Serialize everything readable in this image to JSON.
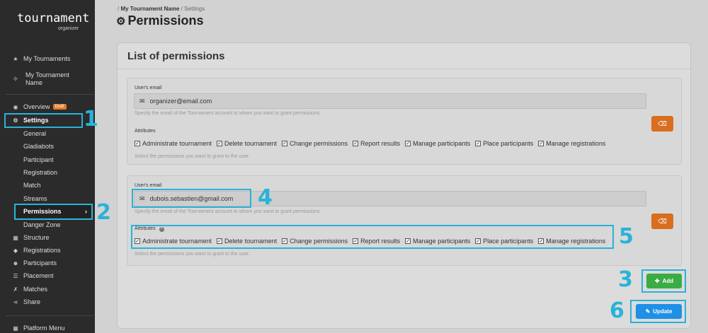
{
  "sidebar": {
    "logo_text": "tournament",
    "logo_sub": "organizer",
    "my_tournaments": "My Tournaments",
    "current_tournament": "My Tournament Name",
    "overview": "Overview",
    "draft_badge": "Draft",
    "settings": "Settings",
    "settings_items": [
      "General",
      "Gladiabots",
      "Participant",
      "Registration",
      "Match",
      "Streams",
      "Permissions",
      "Danger Zone"
    ],
    "structure": "Structure",
    "registrations": "Registrations",
    "participants": "Participants",
    "placement": "Placement",
    "matches": "Matches",
    "share": "Share",
    "platform_menu": "Platform Menu"
  },
  "breadcrumb": {
    "sep1": "/",
    "tournament": "My Tournament Name",
    "sep2": "/",
    "current": "Settings"
  },
  "page_title": "Permissions",
  "card_title": "List of permissions",
  "permissions": [
    {
      "email_label": "User's email",
      "email_value": "organizer@email.com",
      "email_help": "Specify the email of the Toornament account to whom you want to grant permissions.",
      "attributes_label": "Attributes",
      "attributes": [
        "Administrate tournament",
        "Delete tournament",
        "Change permissions",
        "Report results",
        "Manage participants",
        "Place participants",
        "Manage registrations"
      ],
      "attributes_help": "Select the permissions you want to grant to the user."
    },
    {
      "email_label": "User's email",
      "email_value": "dubois.sebastien@gmail.com",
      "email_help": "Specify the email of the Toornament account to whom you want to grant permissions.",
      "attributes_label": "Attributes",
      "attributes": [
        "Administrate tournament",
        "Delete tournament",
        "Change permissions",
        "Report results",
        "Manage participants",
        "Place participants",
        "Manage registrations"
      ],
      "attributes_help": "Select the permissions you want to grant to the user."
    }
  ],
  "buttons": {
    "add": "Add",
    "update": "Update"
  },
  "callouts": [
    "1",
    "2",
    "3",
    "4",
    "5",
    "6"
  ],
  "colors": {
    "callout": "#29b3d8",
    "add_button": "#3aac44",
    "update_button": "#1e90e6",
    "delete_button": "#d86e1e",
    "draft_badge": "#e07b2a"
  }
}
